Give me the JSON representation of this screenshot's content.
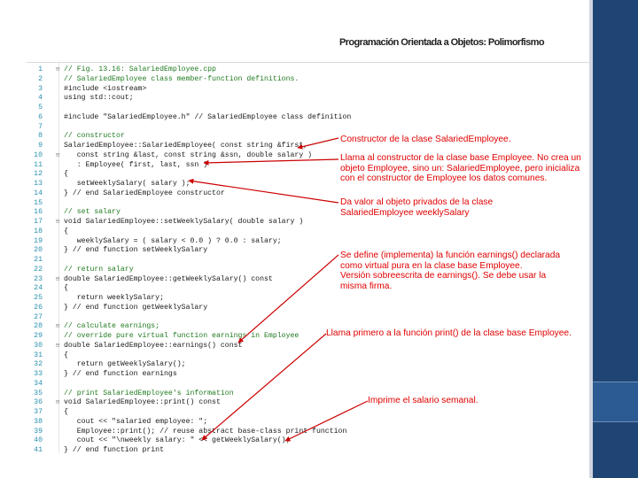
{
  "slide": {
    "title": "Programación Orientada a Objetos: Polimorfismo"
  },
  "code": {
    "lines": [
      {
        "n": "1",
        "fold": "⊟",
        "kind": "comment",
        "text": "// Fig. 13.16: SalariedEmployee.cpp"
      },
      {
        "n": "2",
        "fold": "",
        "kind": "comment",
        "text": "// SalariedEmployee class member-function definitions."
      },
      {
        "n": "3",
        "fold": "",
        "kind": "directive",
        "text": "#include <iostream>"
      },
      {
        "n": "4",
        "fold": "",
        "kind": "code",
        "text": "using std::cout;"
      },
      {
        "n": "5",
        "fold": "",
        "kind": "code",
        "text": ""
      },
      {
        "n": "6",
        "fold": "",
        "kind": "directive",
        "text": "#include \"SalariedEmployee.h\" // SalariedEmployee class definition"
      },
      {
        "n": "7",
        "fold": "",
        "kind": "code",
        "text": ""
      },
      {
        "n": "8",
        "fold": "",
        "kind": "comment",
        "text": "// constructor"
      },
      {
        "n": "9",
        "fold": "",
        "kind": "code",
        "text": "SalariedEmployee::SalariedEmployee( const string &first,"
      },
      {
        "n": "10",
        "fold": "⊟",
        "kind": "code",
        "text": "   const string &last, const string &ssn, double salary )"
      },
      {
        "n": "11",
        "fold": "",
        "kind": "code",
        "text": "   : Employee( first, last, ssn )"
      },
      {
        "n": "12",
        "fold": "",
        "kind": "code",
        "text": "{"
      },
      {
        "n": "13",
        "fold": "",
        "kind": "code",
        "text": "   setWeeklySalary( salary );"
      },
      {
        "n": "14",
        "fold": "",
        "kind": "code",
        "text": "} // end SalariedEmployee constructor"
      },
      {
        "n": "15",
        "fold": "",
        "kind": "code",
        "text": ""
      },
      {
        "n": "16",
        "fold": "",
        "kind": "comment",
        "text": "// set salary"
      },
      {
        "n": "17",
        "fold": "⊟",
        "kind": "code",
        "text": "void SalariedEmployee::setWeeklySalary( double salary )"
      },
      {
        "n": "18",
        "fold": "",
        "kind": "code",
        "text": "{"
      },
      {
        "n": "19",
        "fold": "",
        "kind": "code",
        "text": "   weeklySalary = ( salary < 0.0 ) ? 0.0 : salary;"
      },
      {
        "n": "20",
        "fold": "",
        "kind": "code",
        "text": "} // end function setWeeklySalary"
      },
      {
        "n": "21",
        "fold": "",
        "kind": "code",
        "text": ""
      },
      {
        "n": "22",
        "fold": "",
        "kind": "comment",
        "text": "// return salary"
      },
      {
        "n": "23",
        "fold": "⊟",
        "kind": "code",
        "text": "double SalariedEmployee::getWeeklySalary() const"
      },
      {
        "n": "24",
        "fold": "",
        "kind": "code",
        "text": "{"
      },
      {
        "n": "25",
        "fold": "",
        "kind": "code",
        "text": "   return weeklySalary;"
      },
      {
        "n": "26",
        "fold": "",
        "kind": "code",
        "text": "} // end function getWeeklySalary"
      },
      {
        "n": "27",
        "fold": "",
        "kind": "code",
        "text": ""
      },
      {
        "n": "28",
        "fold": "⊟",
        "kind": "comment",
        "text": "// calculate earnings;"
      },
      {
        "n": "29",
        "fold": "",
        "kind": "comment",
        "text": "// override pure virtual function earnings in Employee"
      },
      {
        "n": "30",
        "fold": "⊟",
        "kind": "code",
        "text": "double SalariedEmployee::earnings() const"
      },
      {
        "n": "31",
        "fold": "",
        "kind": "code",
        "text": "{"
      },
      {
        "n": "32",
        "fold": "",
        "kind": "code",
        "text": "   return getWeeklySalary();"
      },
      {
        "n": "33",
        "fold": "",
        "kind": "code",
        "text": "} // end function earnings"
      },
      {
        "n": "34",
        "fold": "",
        "kind": "code",
        "text": ""
      },
      {
        "n": "35",
        "fold": "",
        "kind": "comment",
        "text": "// print SalariedEmployee's information"
      },
      {
        "n": "36",
        "fold": "⊟",
        "kind": "code",
        "text": "void SalariedEmployee::print() const"
      },
      {
        "n": "37",
        "fold": "",
        "kind": "code",
        "text": "{"
      },
      {
        "n": "38",
        "fold": "",
        "kind": "code",
        "text": "   cout << \"salaried employee: \";"
      },
      {
        "n": "39",
        "fold": "",
        "kind": "code",
        "text": "   Employee::print(); // reuse abstract base-class print function"
      },
      {
        "n": "40",
        "fold": "",
        "kind": "code",
        "text": "   cout << \"\\nweekly salary: \" << getWeeklySalary();"
      },
      {
        "n": "41",
        "fold": "",
        "kind": "code",
        "text": "} // end function print"
      }
    ]
  },
  "annotations": {
    "constructor_note": "Constructor de la clase SalariedEmployee.",
    "base_ctor_note": "Llama al constructor de la clase base Employee. No crea un\nobjeto Employee, sino un: SalariedEmployee, pero inicializa\ncon el constructor de Employee los datos comunes.",
    "set_salary_note": "Da valor al objeto privados de la clase\nSalariedEmployee weeklySalary",
    "earnings_note": "Se define (implementa) la función earnings() declarada\ncomo virtual pura en la clase base Employee.\nVersión sobreescrita de earnings(). Se debe usar la\nmisma firma.",
    "print_call_note": "Llama primero a la función print() de la clase base Employee.",
    "weekly_note": "Imprime el salario semanal."
  },
  "colors": {
    "annotation": "#e00000",
    "arrow": "#cc0000",
    "sidebar": "#1f4575",
    "comment": "#1f7a1f",
    "line_number": "#2b91af"
  }
}
